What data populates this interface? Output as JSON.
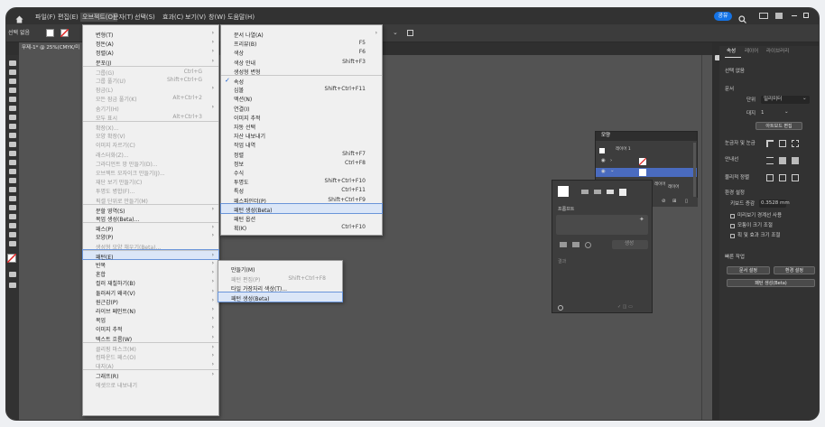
{
  "menubar": {
    "items": [
      "파일(F)",
      "편집(E)",
      "오브젝트(O)",
      "문자(T)",
      "선택(S)",
      "효과(C)",
      "보기(V)",
      "창(W)",
      "도움말(H)"
    ],
    "share_label": "공유"
  },
  "ctrlbar": {
    "selection_label": "선택 없음"
  },
  "document_tab": {
    "title": "무제-1* @ 25%(CMYK/미"
  },
  "object_menu": {
    "items": [
      {
        "label": "변형(T)",
        "shortcut": "",
        "arrow": true,
        "disabled": false
      },
      {
        "label": "정돈(A)",
        "shortcut": "",
        "arrow": true,
        "disabled": false
      },
      {
        "label": "정렬(A)",
        "shortcut": "",
        "arrow": true,
        "disabled": false
      },
      {
        "label": "분포(J)",
        "shortcut": "",
        "arrow": true,
        "disabled": false
      },
      {
        "label": "그룹(G)",
        "shortcut": "Ctrl+G",
        "arrow": false,
        "disabled": true
      },
      {
        "label": "그룹 풀기(U)",
        "shortcut": "Shift+Ctrl+G",
        "arrow": false,
        "disabled": true
      },
      {
        "label": "잠금(L)",
        "shortcut": "",
        "arrow": true,
        "disabled": true
      },
      {
        "label": "모든 잠금 풀기(K)",
        "shortcut": "Alt+Ctrl+2",
        "arrow": false,
        "disabled": true
      },
      {
        "label": "숨기기(H)",
        "shortcut": "",
        "arrow": true,
        "disabled": true
      },
      {
        "label": "모두 표시",
        "shortcut": "Alt+Ctrl+3",
        "arrow": false,
        "disabled": true
      },
      {
        "label": "확장(X)...",
        "shortcut": "",
        "arrow": false,
        "disabled": true
      },
      {
        "label": "모양 확장(V)",
        "shortcut": "",
        "arrow": false,
        "disabled": true
      },
      {
        "label": "이미지 자르기(C)",
        "shortcut": "",
        "arrow": false,
        "disabled": true
      },
      {
        "label": "래스터화(Z)...",
        "shortcut": "",
        "arrow": false,
        "disabled": true
      },
      {
        "label": "그라디언트 망 만들기(D)...",
        "shortcut": "",
        "arrow": false,
        "disabled": true
      },
      {
        "label": "오브젝트 모자이크 만들기(J)...",
        "shortcut": "",
        "arrow": false,
        "disabled": true
      },
      {
        "label": "재단 보기 만들기(C)",
        "shortcut": "",
        "arrow": false,
        "disabled": true
      },
      {
        "label": "투명도 병합(F)...",
        "shortcut": "",
        "arrow": false,
        "disabled": true
      },
      {
        "label": "픽셀 단위로 만들기(M)",
        "shortcut": "",
        "arrow": false,
        "disabled": true
      },
      {
        "label": "분할 영역(S)",
        "shortcut": "",
        "arrow": true,
        "disabled": false
      },
      {
        "label": "목업 생성(Beta)...",
        "shortcut": "",
        "arrow": false,
        "disabled": false
      },
      {
        "label": "패스(P)",
        "shortcut": "",
        "arrow": true,
        "disabled": false
      },
      {
        "label": "모양(P)",
        "shortcut": "",
        "arrow": true,
        "disabled": false
      },
      {
        "label": "생성형 모양 채우기(Beta)...",
        "shortcut": "",
        "arrow": false,
        "disabled": true
      },
      {
        "label": "패턴(E)",
        "shortcut": "",
        "arrow": true,
        "disabled": false
      },
      {
        "label": "반복",
        "shortcut": "",
        "arrow": true,
        "disabled": false
      },
      {
        "label": "혼합",
        "shortcut": "",
        "arrow": true,
        "disabled": false
      },
      {
        "label": "컬러 재칠하기(B)",
        "shortcut": "",
        "arrow": true,
        "disabled": false
      },
      {
        "label": "둘러싸기 왜곡(V)",
        "shortcut": "",
        "arrow": true,
        "disabled": false
      },
      {
        "label": "원근감(P)",
        "shortcut": "",
        "arrow": true,
        "disabled": false
      },
      {
        "label": "라이브 페인트(N)",
        "shortcut": "",
        "arrow": true,
        "disabled": false
      },
      {
        "label": "목업",
        "shortcut": "",
        "arrow": true,
        "disabled": false
      },
      {
        "label": "이미지 추적",
        "shortcut": "",
        "arrow": true,
        "disabled": false
      },
      {
        "label": "텍스트 흐름(W)",
        "shortcut": "",
        "arrow": true,
        "disabled": false
      },
      {
        "label": "클리핑 마스크(M)",
        "shortcut": "",
        "arrow": true,
        "disabled": true
      },
      {
        "label": "컴파운드 패스(O)",
        "shortcut": "",
        "arrow": true,
        "disabled": true
      },
      {
        "label": "대지(A)",
        "shortcut": "",
        "arrow": true,
        "disabled": true
      },
      {
        "label": "그래프(R)",
        "shortcut": "",
        "arrow": true,
        "disabled": false
      },
      {
        "label": "에셋으로 내보내기",
        "shortcut": "",
        "arrow": false,
        "disabled": true
      }
    ]
  },
  "pattern_submenu": {
    "items": [
      {
        "label": "만들기(M)",
        "shortcut": "",
        "disabled": false
      },
      {
        "label": "패턴 편집(P)",
        "shortcut": "Shift+Ctrl+F8",
        "disabled": true
      },
      {
        "label": "타일 가장자리 색상(T)...",
        "shortcut": "",
        "disabled": false
      },
      {
        "label": "패턴 생성(Beta)",
        "shortcut": "",
        "disabled": false
      }
    ]
  },
  "window_menu": {
    "items": [
      {
        "label": "문서 나열(A)",
        "shortcut": "",
        "arrow": true,
        "checked": false
      },
      {
        "label": "프리뷰(B)",
        "shortcut": "F5",
        "arrow": false,
        "checked": false
      },
      {
        "label": "색상",
        "shortcut": "F6",
        "arrow": false,
        "checked": false
      },
      {
        "label": "색상 안내",
        "shortcut": "Shift+F3",
        "arrow": false,
        "checked": false
      },
      {
        "label": "생성형 변형",
        "shortcut": "",
        "arrow": false,
        "checked": false
      },
      {
        "label": "속성",
        "shortcut": "",
        "arrow": false,
        "checked": true
      },
      {
        "label": "심볼",
        "shortcut": "Shift+Ctrl+F11",
        "arrow": false,
        "checked": false
      },
      {
        "label": "액션(N)",
        "shortcut": "",
        "arrow": false,
        "checked": false
      },
      {
        "label": "연결(I)",
        "shortcut": "",
        "arrow": false,
        "checked": false
      },
      {
        "label": "이미지 추적",
        "shortcut": "",
        "arrow": false,
        "checked": false
      },
      {
        "label": "자동 선택",
        "shortcut": "",
        "arrow": false,
        "checked": false
      },
      {
        "label": "자산 내보내기",
        "shortcut": "",
        "arrow": false,
        "checked": false
      },
      {
        "label": "작업 내역",
        "shortcut": "",
        "arrow": false,
        "checked": false
      },
      {
        "label": "정렬",
        "shortcut": "Shift+F7",
        "arrow": false,
        "checked": false
      },
      {
        "label": "정보",
        "shortcut": "Ctrl+F8",
        "arrow": false,
        "checked": false
      },
      {
        "label": "수식",
        "shortcut": "",
        "arrow": false,
        "checked": false
      },
      {
        "label": "투명도",
        "shortcut": "Shift+Ctrl+F10",
        "arrow": false,
        "checked": false
      },
      {
        "label": "특성",
        "shortcut": "Ctrl+F11",
        "arrow": false,
        "checked": false
      },
      {
        "label": "패스파인더(P)",
        "shortcut": "Shift+Ctrl+F9",
        "arrow": false,
        "checked": false
      },
      {
        "label": "패턴 생성(Beta)",
        "shortcut": "",
        "arrow": false,
        "checked": false
      },
      {
        "label": "패턴 옵션",
        "shortcut": "",
        "arrow": false,
        "checked": false
      },
      {
        "label": "획(K)",
        "shortcut": "Ctrl+F10",
        "arrow": false,
        "checked": false
      }
    ]
  },
  "layers_panel": {
    "tab": "모양",
    "rows": [
      "레이어 1",
      "",
      "",
      ""
    ],
    "sub_text": "레이어",
    "sub_text2": "레이어"
  },
  "prompt_panel": {
    "label": "프롬프트",
    "gen_button": "생성",
    "bottom_label": "결과"
  },
  "properties_panel": {
    "tabs": [
      "속성",
      "레이어",
      "라이브러리"
    ],
    "selection": "선택 없음",
    "doc_section": "문서",
    "unit_label": "단위",
    "unit_value": "밀리미터",
    "artboard_label": "대지",
    "artboard_value": "1",
    "edit_artboard_button": "아트보드 편집",
    "ruler_grid_label": "눈금자 및 눈금",
    "guides_label": "안내선",
    "snap_label": "물리적 정렬",
    "prefs_label": "환경 설정",
    "keyboard_increment_label": "키보드 증감",
    "keyboard_increment_value": "0.3528 mm",
    "check1": "미리보기 경계선 사용",
    "check2": "모퉁이 크기 조절",
    "check3": "획 및 효과 크기 조절",
    "quick_actions_label": "빠른 작업",
    "doc_setup_button": "문서 설정",
    "prefs_button": "환경 설정",
    "pattern_button": "패턴 생성(Beta)"
  }
}
